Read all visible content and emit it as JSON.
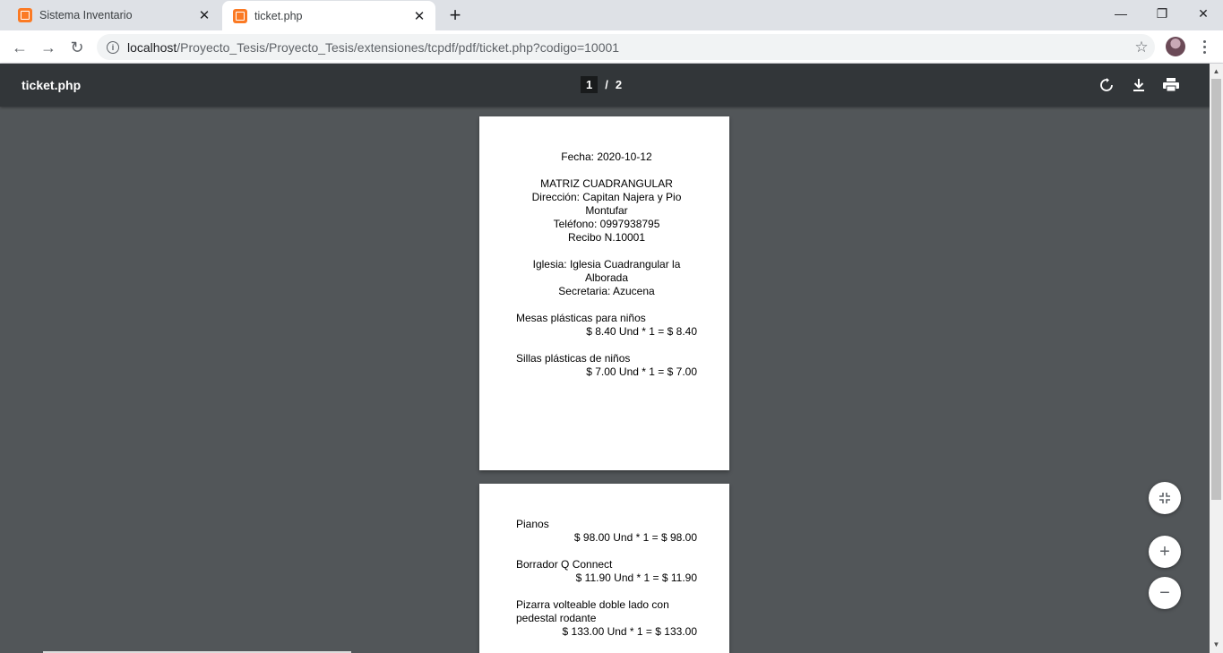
{
  "tabs": [
    {
      "title": "Sistema Inventario"
    },
    {
      "title": "ticket.php"
    }
  ],
  "window_controls": {
    "minimize": "—",
    "restore": "❐",
    "close": "✕"
  },
  "toolbar": {
    "url_host": "localhost",
    "url_path": "/Proyecto_Tesis/Proyecto_Tesis/extensiones/tcpdf/pdf/ticket.php?codigo=10001"
  },
  "pdf_viewer": {
    "title": "ticket.php",
    "current_page": "1",
    "separator": "/",
    "total_pages": "2"
  },
  "ticket": {
    "fecha": "Fecha: 2020-10-12",
    "matriz": "MATRIZ CUADRANGULAR",
    "direccion": "Dirección: Capitan Najera y Pio Montufar",
    "telefono": "Teléfono: 0997938795",
    "recibo": "Recibo N.10001",
    "iglesia": "Iglesia: Iglesia Cuadrangular la Alborada",
    "secretaria": "Secretaria: Azucena",
    "items": [
      {
        "name": "Mesas plásticas para niños",
        "line": "$ 8.40 Und * 1 = $ 8.40"
      },
      {
        "name": "Sillas plásticas de niños",
        "line": "$ 7.00 Und * 1 = $ 7.00"
      },
      {
        "name": "Pianos",
        "line": "$ 98.00 Und * 1 = $ 98.00"
      },
      {
        "name": "Borrador Q Connect",
        "line": "$ 11.90 Und * 1 = $ 11.90"
      },
      {
        "name": "Pizarra volteable doble lado con pedestal rodante",
        "line": "$ 133.00 Und * 1 = $ 133.00"
      }
    ]
  },
  "colors": {
    "tabstrip": "#dee1e6",
    "pdf_toolbar": "#323639",
    "viewer_background": "#525659",
    "favicon": "#fb7a24"
  }
}
